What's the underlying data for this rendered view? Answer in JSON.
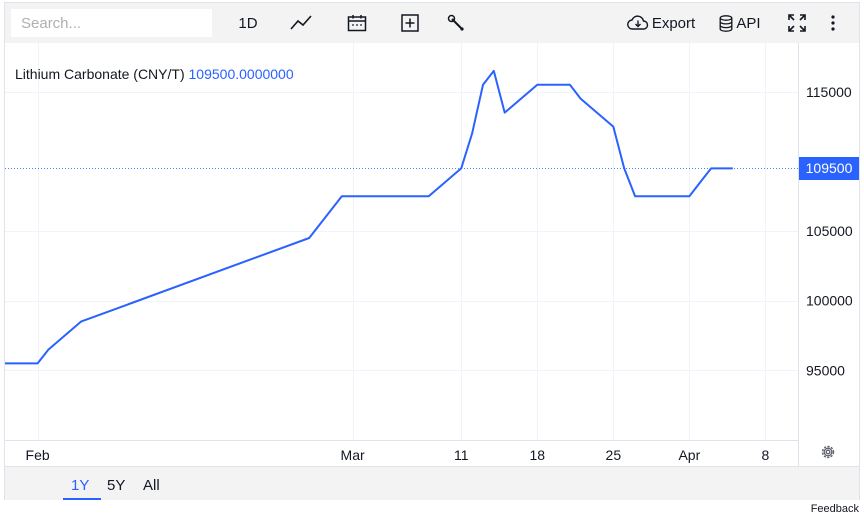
{
  "toolbar": {
    "search_placeholder": "Search...",
    "interval": "1D",
    "export_label": "Export",
    "api_label": "API"
  },
  "legend": {
    "name": "Lithium Carbonate (CNY/T)",
    "value": "109500.0000000"
  },
  "price_tag": "109500",
  "ranges": [
    "1Y",
    "5Y",
    "All"
  ],
  "active_range": "1Y",
  "feedback": "Feedback",
  "colors": {
    "line": "#2962ff",
    "grid": "#f0f3fa",
    "toolbar_bg": "#f3f3f3"
  },
  "chart_data": {
    "type": "line",
    "title": "Lithium Carbonate (CNY/T)",
    "x_tick_labels": [
      "Feb",
      "Mar",
      "11",
      "18",
      "25",
      "Apr",
      "8"
    ],
    "x_tick_dates": [
      "2024-02-01",
      "2024-03-01",
      "2024-03-11",
      "2024-03-18",
      "2024-03-25",
      "2024-04-01",
      "2024-04-08"
    ],
    "x_range": [
      "2024-01-29",
      "2024-04-11"
    ],
    "y_ticks": [
      95000,
      100000,
      105000,
      109500,
      115000
    ],
    "y_tick_labels": [
      "95000",
      "100000",
      "105000",
      "",
      "115000"
    ],
    "ylim": [
      90000,
      118500
    ],
    "last_value": 109500,
    "axis_position": "right",
    "grid": true,
    "series": [
      {
        "values": [
          {
            "x": "2024-01-29",
            "y": 95500
          },
          {
            "x": "2024-02-01",
            "y": 95500
          },
          {
            "x": "2024-02-02",
            "y": 96500
          },
          {
            "x": "2024-02-05",
            "y": 98500
          },
          {
            "x": "2024-02-26",
            "y": 104500
          },
          {
            "x": "2024-02-29",
            "y": 107500
          },
          {
            "x": "2024-03-07",
            "y": 107500
          },
          {
            "x": "2024-03-08",
            "y": 107500
          },
          {
            "x": "2024-03-11",
            "y": 109500
          },
          {
            "x": "2024-03-12",
            "y": 112000
          },
          {
            "x": "2024-03-13",
            "y": 115500
          },
          {
            "x": "2024-03-14",
            "y": 116500
          },
          {
            "x": "2024-03-15",
            "y": 113500
          },
          {
            "x": "2024-03-18",
            "y": 115500
          },
          {
            "x": "2024-03-19",
            "y": 115500
          },
          {
            "x": "2024-03-20",
            "y": 115500
          },
          {
            "x": "2024-03-21",
            "y": 115500
          },
          {
            "x": "2024-03-22",
            "y": 114500
          },
          {
            "x": "2024-03-25",
            "y": 112500
          },
          {
            "x": "2024-03-26",
            "y": 109500
          },
          {
            "x": "2024-03-27",
            "y": 107500
          },
          {
            "x": "2024-03-28",
            "y": 107500
          },
          {
            "x": "2024-03-29",
            "y": 107500
          },
          {
            "x": "2024-04-01",
            "y": 107500
          },
          {
            "x": "2024-04-02",
            "y": 108500
          },
          {
            "x": "2024-04-03",
            "y": 109500
          },
          {
            "x": "2024-04-04",
            "y": 109500
          },
          {
            "x": "2024-04-05",
            "y": 109500
          }
        ]
      }
    ]
  }
}
